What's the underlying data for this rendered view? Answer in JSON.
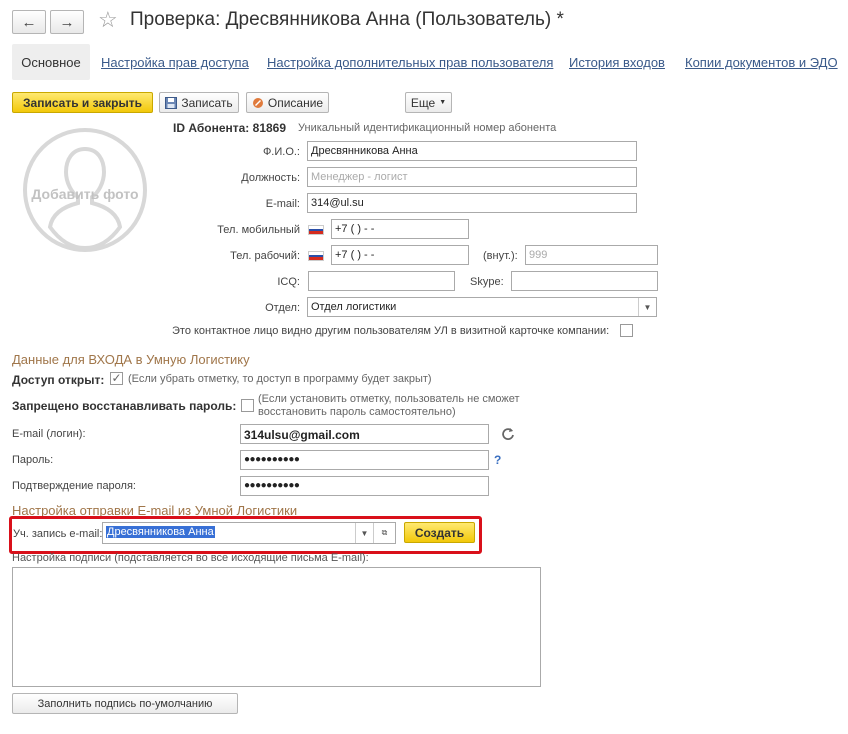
{
  "window": {
    "title": "Проверка: Дресвянникова Анна (Пользователь) *"
  },
  "nav": {
    "back_icon": "←",
    "forward_icon": "→"
  },
  "tabs": [
    {
      "label": "Основное"
    },
    {
      "label": "Настройка прав доступа"
    },
    {
      "label": "Настройка дополнительных прав пользователя"
    },
    {
      "label": "История входов"
    },
    {
      "label": "Копии документов и ЭДО"
    }
  ],
  "toolbar": {
    "save_close": "Записать и закрыть",
    "save": "Записать",
    "description": "Описание",
    "more": "Еще"
  },
  "photo": {
    "label": "Добавить фото"
  },
  "subscriber": {
    "label": "ID Абонента:",
    "value": "81869",
    "hint": "Уникальный идентификационный номер абонента"
  },
  "form": {
    "fio_label": "Ф.И.О.:",
    "fio_value": "Дресвянникова Анна",
    "position_label": "Должность:",
    "position_placeholder": "Менеджер - логист",
    "email_label": "E-mail:",
    "email_value": "314@ul.su",
    "mobile_label": "Тел. мобильный",
    "mobile_value": "+7 (   )    -   -",
    "work_label": "Тел. рабочий:",
    "work_value": "+7 (   )    -   -",
    "ext_label": "(внут.):",
    "ext_placeholder": "999",
    "icq_label": "ICQ:",
    "icq_value": "",
    "skype_label": "Skype:",
    "skype_value": "",
    "dept_label": "Отдел:",
    "dept_value": "Отдел логистики",
    "visible_label": "Это контактное лицо видно другим пользователям УЛ в визитной карточке компании:"
  },
  "login_section": {
    "title": "Данные для ВХОДА в Умную Логистику",
    "access_label": "Доступ открыт:",
    "access_checked": true,
    "access_hint": "(Если убрать отметку, то доступ в программу будет закрыт)",
    "restore_label": "Запрещено восстанавливать пароль:",
    "restore_checked": false,
    "restore_hint_1": "(Если установить отметку, пользователь не сможет",
    "restore_hint_2": "восстановить пароль самостоятельно)",
    "login_label": "E-mail (логин):",
    "login_value": "314ulsu@gmail.com",
    "password_label": "Пароль:",
    "password_value": "●●●●●●●●●●",
    "help": "?",
    "confirm_label": "Подтверждение пароля:",
    "confirm_value": "●●●●●●●●●●"
  },
  "email_section": {
    "title": "Настройка отправки E-mail из Умной Логистики",
    "account_label": "Уч. запись e-mail:",
    "account_value": "Дресвянникова Анна",
    "create_button": "Создать",
    "signature_label": "Настройка подписи (подставляется во все исходящие письма E-mail):",
    "signature_value": "",
    "fill_default_button": "Заполнить подпись по-умолчанию"
  },
  "colors": {
    "accent_yellow": "#f5d023",
    "highlight_red": "#d9101a",
    "section_brown": "#a0764a",
    "link_blue": "#3a5a8a"
  }
}
